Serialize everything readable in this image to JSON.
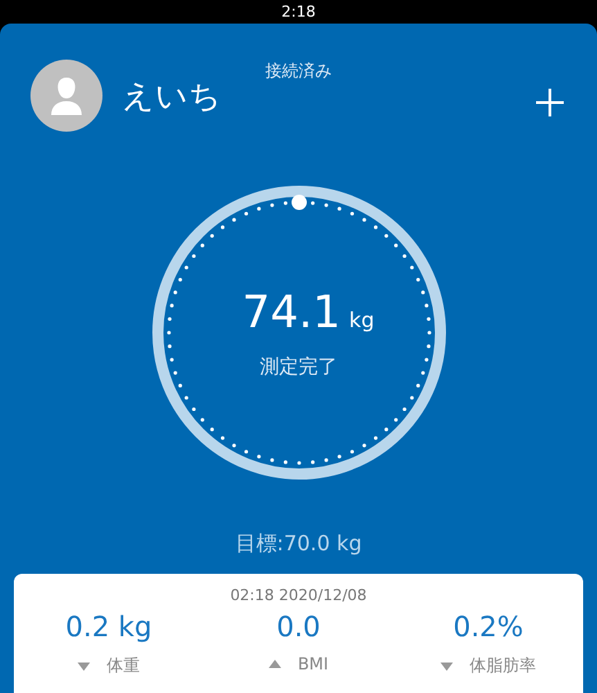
{
  "status_bar": {
    "time": "2:18"
  },
  "header": {
    "connection": "接続済み",
    "user_name": "えいち"
  },
  "measurement": {
    "value": "74.1",
    "unit": "kg",
    "status": "測定完了"
  },
  "goal": "目標:70.0 kg",
  "summary": {
    "timestamp": "02:18 2020/12/08",
    "items": [
      {
        "value": "0.2 kg",
        "label": "体重",
        "increased": false
      },
      {
        "value": "0.0",
        "label": "BMI",
        "increased": true
      },
      {
        "value": "0.2%",
        "label": "体脂肪率",
        "increased": false
      }
    ]
  }
}
